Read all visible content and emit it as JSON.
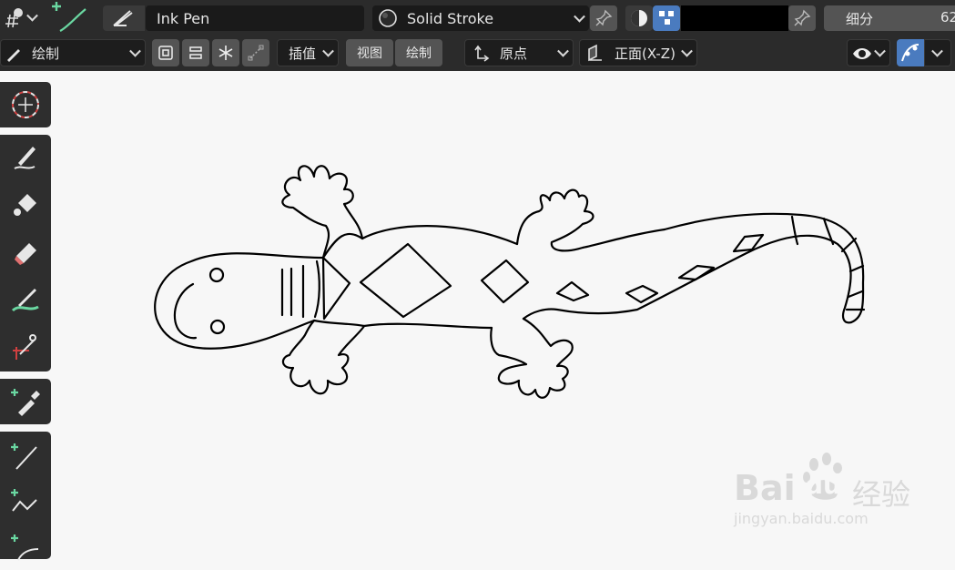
{
  "header": {
    "brush_name": "Ink Pen",
    "stroke_material": "Solid Stroke",
    "subdivide_label": "细分",
    "subdivide_value": "62"
  },
  "toolbar": {
    "mode": "绘制",
    "interpolate": "插值",
    "view_tab": "视图",
    "draw_tab": "绘制",
    "origin": "原点",
    "orientation": "正面(X-Z)"
  },
  "watermark": {
    "brand": "Bai",
    "brand2": "du",
    "cn": "经验",
    "url": "jingyan.baidu.com"
  },
  "colors": {
    "panel_bg": "#2b2b2b",
    "canvas_bg": "#f7f7f7",
    "accent_blue": "#4a7bbf",
    "plus_green": "#6ad7a1"
  },
  "icons": [
    "gpencil-object-icon",
    "add-stroke-icon",
    "pen-brush-icon",
    "material-sphere-icon",
    "pin-icon",
    "cursor-icon",
    "draw-tool-icon",
    "fill-tool-icon",
    "erase-tool-icon",
    "tint-tool-icon",
    "cutter-tool-icon",
    "eyedropper-icon",
    "line-tool-icon",
    "polyline-tool-icon",
    "arc-tool-icon",
    "visibility-eye-icon",
    "overlay-icon"
  ]
}
